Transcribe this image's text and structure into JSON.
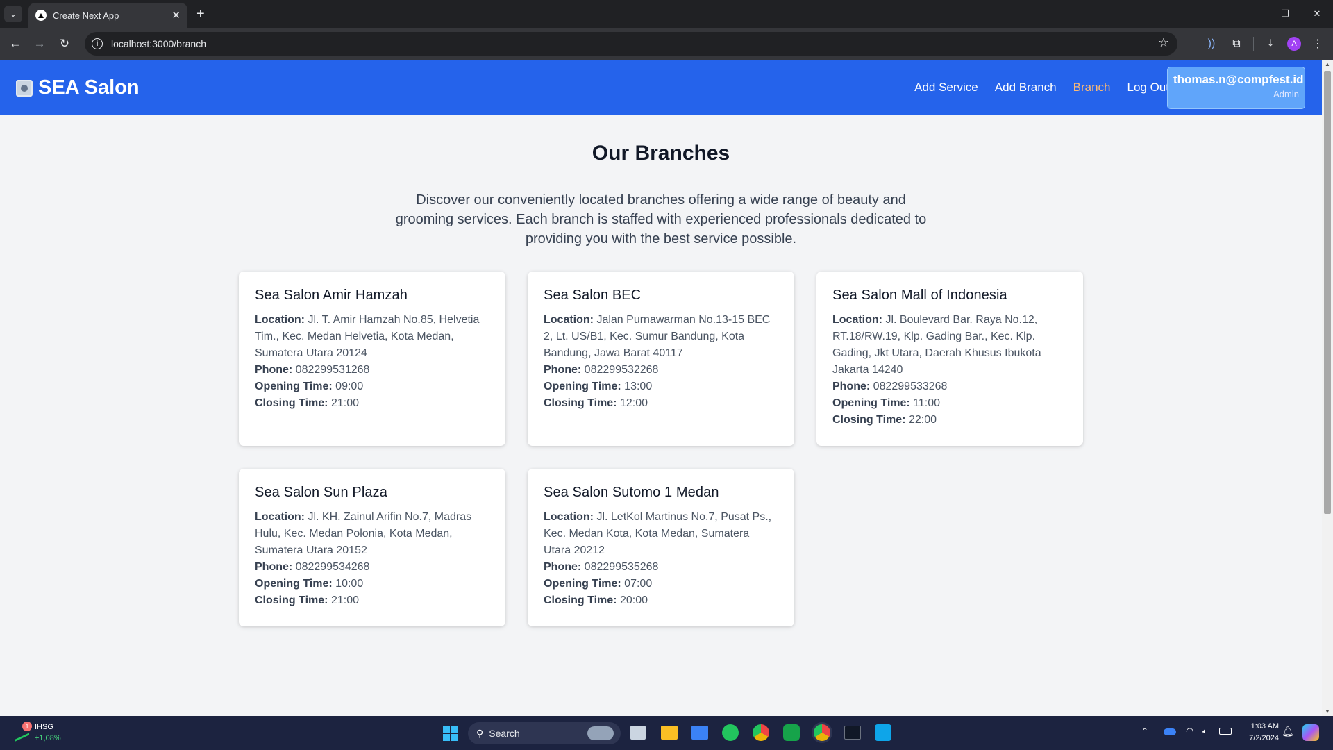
{
  "browser": {
    "tab_title": "Create Next App",
    "url": "localhost:3000/branch",
    "profile_initial": "A"
  },
  "header": {
    "brand": "SEA Salon",
    "nav": [
      {
        "label": "Add Service",
        "active": false
      },
      {
        "label": "Add Branch",
        "active": false
      },
      {
        "label": "Branch",
        "active": true
      },
      {
        "label": "Log Out",
        "active": false
      }
    ],
    "user_email": "thomas.n@compfest.id",
    "user_role": "Admin"
  },
  "main": {
    "title": "Our Branches",
    "intro": "Discover our conveniently located branches offering a wide range of beauty and grooming services. Each branch is staffed with experienced professionals dedicated to providing you with the best service possible.",
    "labels": {
      "location": "Location:",
      "phone": "Phone:",
      "opening": "Opening Time:",
      "closing": "Closing Time:"
    },
    "branches": [
      {
        "name": "Sea Salon Amir Hamzah",
        "location": "Jl. T. Amir Hamzah No.85, Helvetia Tim., Kec. Medan Helvetia, Kota Medan, Sumatera Utara 20124",
        "phone": "082299531268",
        "opening": "09:00",
        "closing": "21:00"
      },
      {
        "name": "Sea Salon BEC",
        "location": "Jalan Purnawarman No.13-15 BEC 2, Lt. US/B1, Kec. Sumur Bandung, Kota Bandung, Jawa Barat 40117",
        "phone": "082299532268",
        "opening": "13:00",
        "closing": "12:00"
      },
      {
        "name": "Sea Salon Mall of Indonesia",
        "location": "Jl. Boulevard Bar. Raya No.12, RT.18/RW.19, Klp. Gading Bar., Kec. Klp. Gading, Jkt Utara, Daerah Khusus Ibukota Jakarta 14240",
        "phone": "082299533268",
        "opening": "11:00",
        "closing": "22:00"
      },
      {
        "name": "Sea Salon Sun Plaza",
        "location": "Jl. KH. Zainul Arifin No.7, Madras Hulu, Kec. Medan Polonia, Kota Medan, Sumatera Utara 20152",
        "phone": "082299534268",
        "opening": "10:00",
        "closing": "21:00"
      },
      {
        "name": "Sea Salon Sutomo 1 Medan",
        "location": "Jl. LetKol Martinus No.7, Pusat Ps., Kec. Medan Kota, Kota Medan, Sumatera Utara 20212",
        "phone": "082299535268",
        "opening": "07:00",
        "closing": "20:00"
      }
    ]
  },
  "taskbar": {
    "stock_name": "IHSG",
    "stock_change": "+1,08%",
    "stock_badge": "1",
    "search_placeholder": "Search",
    "time": "1:03 AM",
    "date": "7/2/2024"
  },
  "colors": {
    "header_bg": "#2563eb",
    "active_nav": "#fdba74",
    "page_bg": "#f3f4f6"
  }
}
